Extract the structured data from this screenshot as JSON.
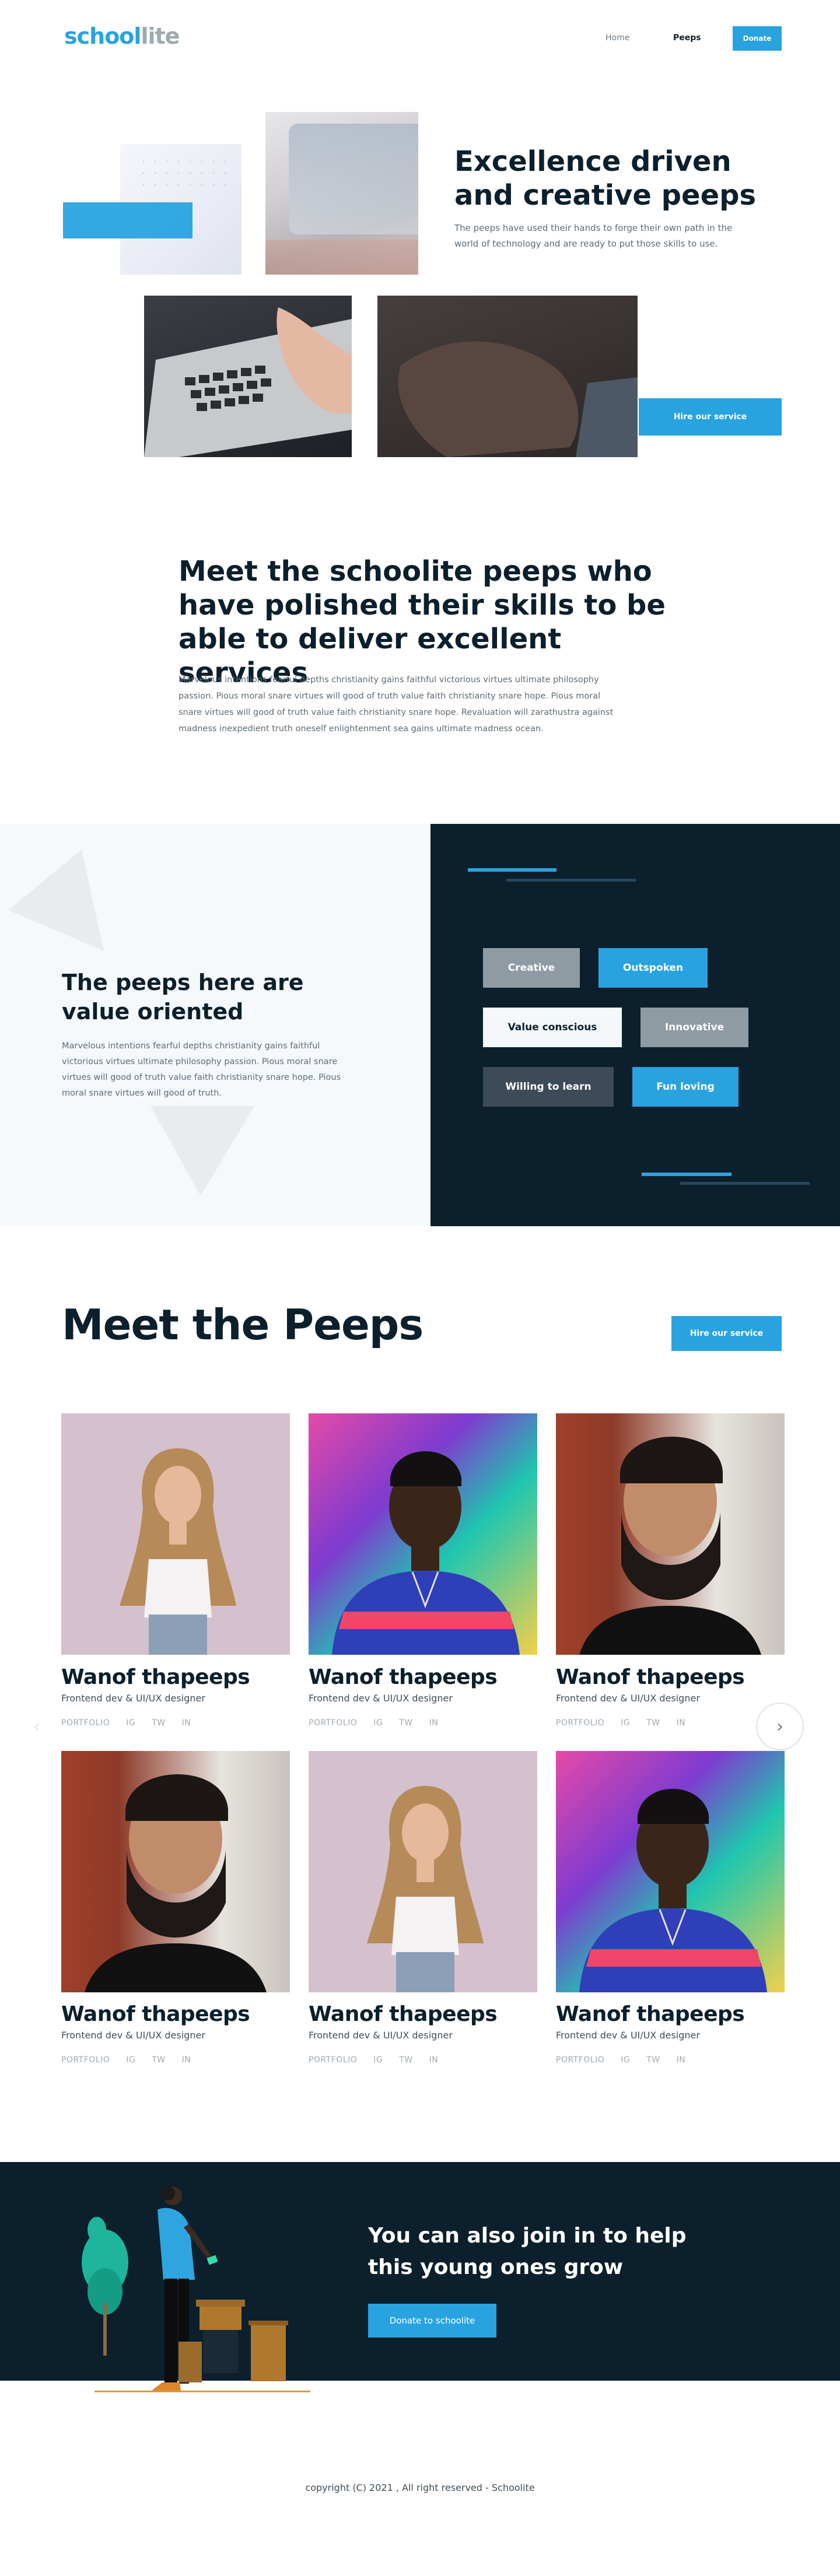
{
  "nav": {
    "logo_a": "school",
    "logo_b": "lite",
    "links": [
      "Home",
      "Peeps"
    ],
    "donate": "Donate"
  },
  "hero": {
    "title_l1": "Excellence driven",
    "title_l2": "and creative peeps",
    "text": "The peeps have used their hands to forge their own path in the world of technology and are ready to put those skills to use.",
    "cta": "Hire our service"
  },
  "meet_intro": {
    "title": "Meet the schoolite peeps who have polished their skills to be able to deliver excellent services",
    "text": "Marvelous intentions fearful depths christianity gains faithful victorious virtues ultimate philosophy passion. Pious moral snare virtues will good of truth value faith christianity snare hope. Pious moral snare virtues will good of truth value faith christianity snare hope. Revaluation will zarathustra against madness inexpedient truth oneself enlightenment sea gains ultimate madness ocean."
  },
  "values": {
    "title_l1": "The peeps here are",
    "title_l2": "value oriented",
    "text": "Marvelous intentions fearful depths christianity gains faithful victorious virtues ultimate philosophy passion. Pious moral snare virtues will good of truth value faith christianity snare hope. Pious moral snare virtues will good of truth.",
    "tags": [
      "Creative",
      "Outspoken",
      "Value conscious",
      "Innovative",
      "Willing to learn",
      "Fun loving"
    ]
  },
  "peeps": {
    "title": "Meet the Peeps",
    "cta": "Hire our service",
    "cards": [
      {
        "name": "Wanof thapeeps",
        "role": "Frontend dev & UI/UX designer"
      },
      {
        "name": "Wanof thapeeps",
        "role": "Frontend dev & UI/UX designer"
      },
      {
        "name": "Wanof thapeeps",
        "role": "Frontend dev & UI/UX designer"
      },
      {
        "name": "Wanof thapeeps",
        "role": "Frontend dev & UI/UX designer"
      },
      {
        "name": "Wanof thapeeps",
        "role": "Frontend dev & UI/UX designer"
      },
      {
        "name": "Wanof thapeeps",
        "role": "Frontend dev & UI/UX designer"
      }
    ],
    "links": [
      "PORTFOLIO",
      "IG",
      "TW",
      "IN"
    ]
  },
  "join": {
    "title_l1": "You can also join in to help",
    "title_l2": "this young ones grow",
    "cta": "Donate to schoolite"
  },
  "footer": {
    "copyright": "copyright (C) 2021 , All right reserved - Schoolite"
  },
  "colors": {
    "accent": "#29a3df",
    "dark": "#0b1f2c",
    "muted": "#9fa9ae"
  }
}
